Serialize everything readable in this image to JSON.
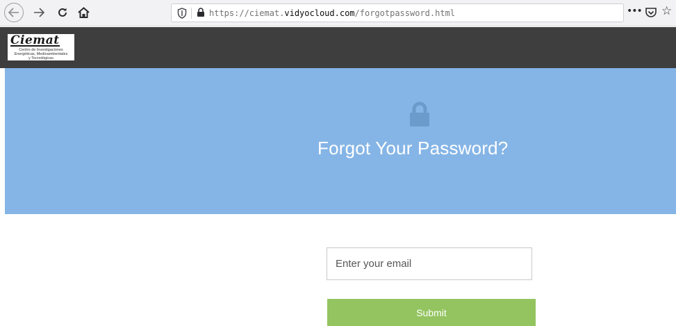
{
  "browser": {
    "url_prefix": "https://ciemat.",
    "url_domain": "vidyocloud.com",
    "url_path": "/forgotpassword.html",
    "more_label": "•••"
  },
  "logo": {
    "wordmark": "Ciemat",
    "tagline_line1": "Centro de Investigaciones",
    "tagline_line2": "Energéticas, Medioambientales",
    "tagline_line3": "y Tecnológicas"
  },
  "hero": {
    "title": "Forgot Your Password?"
  },
  "form": {
    "email_placeholder": "Enter your email",
    "submit_label": "Submit"
  },
  "colors": {
    "header_bg": "#3e3e3e",
    "hero_bg": "#85b5e6",
    "submit_bg": "#93c45f"
  }
}
